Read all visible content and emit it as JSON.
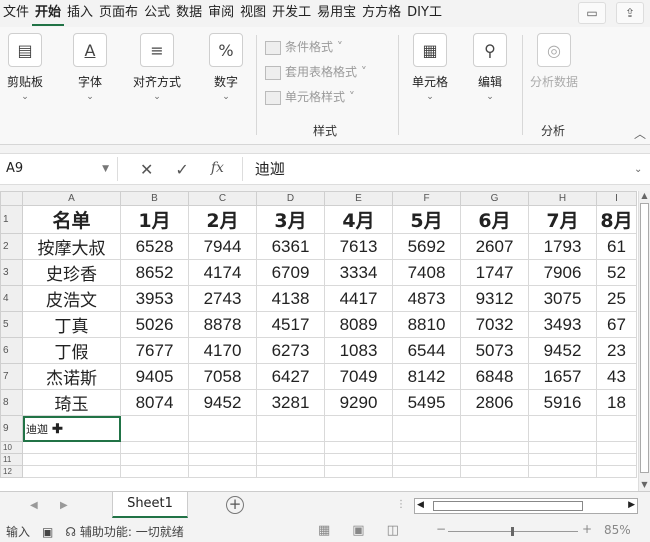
{
  "ribbon_tabs": [
    "文件",
    "开始",
    "插入",
    "页面布",
    "公式",
    "数据",
    "审阅",
    "视图",
    "开发工",
    "易用宝",
    "方方格",
    "DIY工"
  ],
  "active_tab": "开始",
  "ribbon_groups": {
    "clipboard": "剪贴板",
    "font": "字体",
    "align": "对齐方式",
    "number": "数字",
    "cells": "单元格",
    "edit": "编辑",
    "analysis_button": "分析数据",
    "analysis_group": "分析",
    "styles_group": "样式"
  },
  "style_items": [
    "条件格式 ˅",
    "套用表格格式 ˅",
    "单元格样式 ˅"
  ],
  "number_icon": "%",
  "font_icon": "A",
  "formula_bar": {
    "name_box": "A9",
    "cancel": "✕",
    "enter": "✓",
    "fx": "fx",
    "value": "迪迦"
  },
  "columns": [
    "A",
    "B",
    "C",
    "D",
    "E",
    "F",
    "G",
    "H",
    "I"
  ],
  "rows": [
    "1",
    "2",
    "3",
    "4",
    "5",
    "6",
    "7",
    "8",
    "9",
    "10",
    "11",
    "12"
  ],
  "header_row": [
    "名单",
    "1月",
    "2月",
    "3月",
    "4月",
    "5月",
    "6月",
    "7月",
    "8月"
  ],
  "data_rows": [
    [
      "按摩大叔",
      "6528",
      "7944",
      "6361",
      "7613",
      "5692",
      "2607",
      "1793",
      "61"
    ],
    [
      "史珍香",
      "8652",
      "4174",
      "6709",
      "3334",
      "7408",
      "1747",
      "7906",
      "52"
    ],
    [
      "皮浩文",
      "3953",
      "2743",
      "4138",
      "4417",
      "4873",
      "9312",
      "3075",
      "25"
    ],
    [
      "丁真",
      "5026",
      "8878",
      "4517",
      "8089",
      "8810",
      "7032",
      "3493",
      "67"
    ],
    [
      "丁假",
      "7677",
      "4170",
      "6273",
      "1083",
      "6544",
      "5073",
      "9452",
      "23"
    ],
    [
      "杰诺斯",
      "9405",
      "7058",
      "6427",
      "7049",
      "8142",
      "6848",
      "1657",
      "43"
    ],
    [
      "琦玉",
      "8074",
      "9452",
      "3281",
      "9290",
      "5495",
      "2806",
      "5916",
      "18"
    ]
  ],
  "active_cell_text": "迪迦",
  "sheet_tab": "Sheet1",
  "status": {
    "mode": "输入",
    "accessibility": "辅助功能: 一切就绪",
    "zoom": "85%"
  },
  "colors": {
    "accent": "#217346",
    "grid": "#d9d9d9"
  }
}
